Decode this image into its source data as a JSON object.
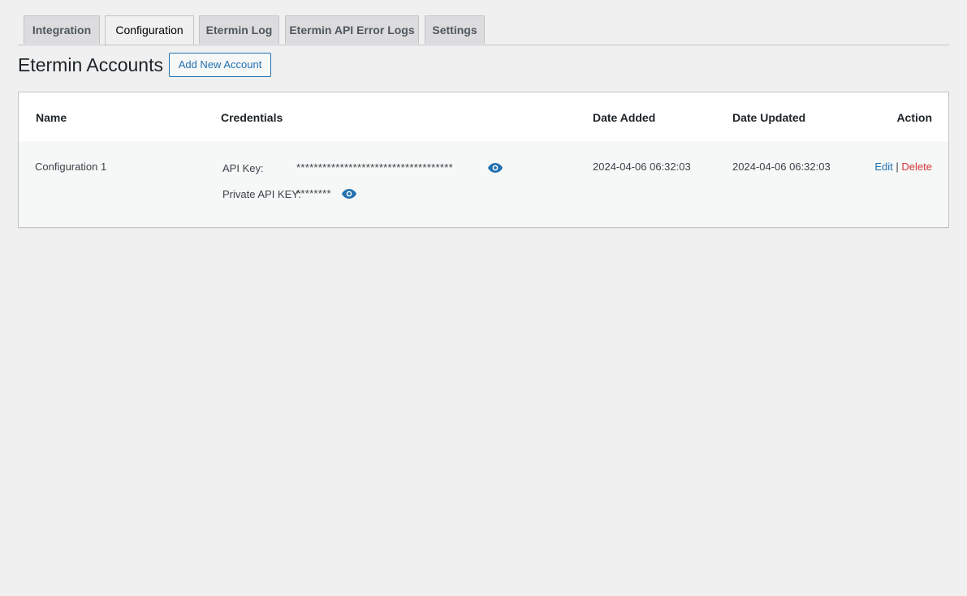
{
  "tabs": [
    {
      "label": "Integration",
      "active": false
    },
    {
      "label": "Configuration",
      "active": true
    },
    {
      "label": "Etermin Log",
      "active": false
    },
    {
      "label": "Etermin API Error Logs",
      "active": false
    },
    {
      "label": "Settings",
      "active": false
    }
  ],
  "page": {
    "title": "Etermin Accounts",
    "add_button": "Add New Account"
  },
  "table": {
    "headers": {
      "name": "Name",
      "credentials": "Credentials",
      "date_added": "Date Added",
      "date_updated": "Date Updated",
      "action": "Action"
    },
    "rows": [
      {
        "name": "Configuration 1",
        "api_key_label": "API Key:",
        "api_key_value": "************************************",
        "private_key_label": "Private API KEY:",
        "private_key_value": "********",
        "date_added": "2024-04-06 06:32:03",
        "date_updated": "2024-04-06 06:32:03",
        "edit_label": "Edit",
        "separator": "|",
        "delete_label": "Delete"
      }
    ]
  },
  "colors": {
    "accent": "#2271b1",
    "danger": "#d63638",
    "background": "#f0f0f1"
  },
  "icons": {
    "reveal": "eye-icon"
  }
}
